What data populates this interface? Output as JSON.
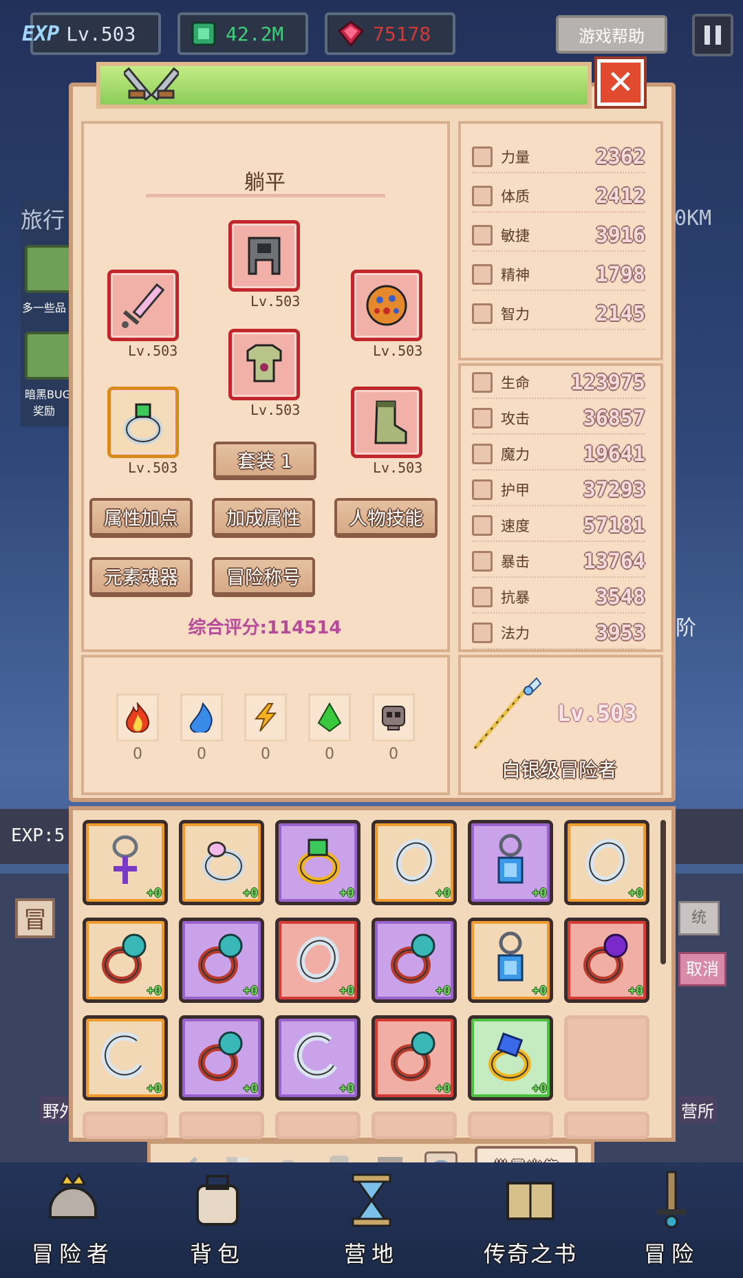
{
  "top": {
    "exp_label": "EXP",
    "level": "Lv.503",
    "gems": "42.2M",
    "rubies": "75178",
    "help": "游戏帮助"
  },
  "background": {
    "left_label": "旅行",
    "right_label": "0KM",
    "side_item_1": "多一些品",
    "side_item_2a": "暗黑BUG",
    "side_item_2b": "奖励",
    "exp_prefix": "EXP:5",
    "adv_char": "冒",
    "right_btn": "统",
    "cancel": "取消",
    "tier": "阶",
    "map_left": "野外",
    "map_right": "营所"
  },
  "character": {
    "name": "躺平",
    "slots": [
      {
        "name": "weapon",
        "level": "Lv.503"
      },
      {
        "name": "helmet",
        "level": "Lv.503"
      },
      {
        "name": "amulet",
        "level": "Lv.503"
      },
      {
        "name": "armor",
        "level": "Lv.503"
      },
      {
        "name": "ring",
        "level": "Lv.503"
      },
      {
        "name": "boots",
        "level": "Lv.503"
      }
    ],
    "set_button": "套装 1",
    "buttons": [
      "属性加点",
      "加成属性",
      "人物技能",
      "元素魂器",
      "冒险称号"
    ],
    "score": "综合评分:114514"
  },
  "elements": [
    {
      "name": "fire",
      "value": "0"
    },
    {
      "name": "water",
      "value": "0"
    },
    {
      "name": "lightning",
      "value": "0"
    },
    {
      "name": "nature",
      "value": "0"
    },
    {
      "name": "dark",
      "value": "0"
    }
  ],
  "base_stats": [
    {
      "label": "力量",
      "value": "2362",
      "icon": "strength-icon"
    },
    {
      "label": "体质",
      "value": "2412",
      "icon": "heart-icon"
    },
    {
      "label": "敏捷",
      "value": "3916",
      "icon": "boot-icon"
    },
    {
      "label": "精神",
      "value": "1798",
      "icon": "star-icon"
    },
    {
      "label": "智力",
      "value": "2145",
      "icon": "brain-icon"
    }
  ],
  "combat_stats": [
    {
      "label": "生命",
      "value": "123975",
      "icon": "heart-icon"
    },
    {
      "label": "攻击",
      "value": "36857",
      "icon": "sword-icon"
    },
    {
      "label": "魔力",
      "value": "19641",
      "icon": "wand-icon"
    },
    {
      "label": "护甲",
      "value": "37293",
      "icon": "shield-icon"
    },
    {
      "label": "速度",
      "value": "57181",
      "icon": "boot-icon"
    },
    {
      "label": "暴击",
      "value": "13764",
      "icon": "crit-icon"
    },
    {
      "label": "抗暴",
      "value": "3548",
      "icon": "crit-icon"
    },
    {
      "label": "法力",
      "value": "3953",
      "icon": "star-icon"
    }
  ],
  "title_card": {
    "level": "Lv.503",
    "rank": "白银级冒险者"
  },
  "inventory": {
    "bonus": "+0",
    "items": [
      {
        "quality": "orange",
        "icon": "cross-necklace-icon"
      },
      {
        "quality": "orange",
        "icon": "pink-gem-ring-icon"
      },
      {
        "quality": "purple",
        "icon": "gold-emerald-ring-icon"
      },
      {
        "quality": "orange",
        "icon": "silver-band-icon"
      },
      {
        "quality": "purple",
        "icon": "sapphire-necklace-icon"
      },
      {
        "quality": "orange",
        "icon": "silver-band-icon"
      },
      {
        "quality": "orange",
        "icon": "pearl-ring-icon"
      },
      {
        "quality": "purple",
        "icon": "pearl-ring-icon"
      },
      {
        "quality": "red",
        "icon": "silver-band-icon"
      },
      {
        "quality": "purple",
        "icon": "pearl-ring-icon"
      },
      {
        "quality": "orange",
        "icon": "sapphire-necklace-icon"
      },
      {
        "quality": "red",
        "icon": "amethyst-ring-icon"
      },
      {
        "quality": "orange",
        "icon": "silver-spiral-ring-icon"
      },
      {
        "quality": "purple",
        "icon": "pearl-ring-icon"
      },
      {
        "quality": "purple",
        "icon": "silver-spiral-ring-icon"
      },
      {
        "quality": "red",
        "icon": "pearl-ring-icon"
      },
      {
        "quality": "green",
        "icon": "gold-sapphire-ring-icon"
      },
      {
        "quality": "empty",
        "icon": ""
      }
    ]
  },
  "tabs": {
    "icons": [
      "sword-tab-icon",
      "armor-tab-icon",
      "helmet-tab-icon",
      "chest-tab-icon",
      "boots-tab-icon",
      "ring-tab-icon"
    ],
    "batch_sell": "批量出售"
  },
  "nav": [
    "冒险者",
    "背包",
    "营地",
    "传奇之书",
    "冒险"
  ],
  "colors": {
    "quality_orange": "#ee9a2c",
    "quality_purple": "#9a62cc",
    "quality_red": "#d63a34",
    "quality_green": "#4cc23e",
    "score": "#b84a9a",
    "gem_text": "#3fcf7a",
    "ruby_text": "#d23a3a"
  }
}
